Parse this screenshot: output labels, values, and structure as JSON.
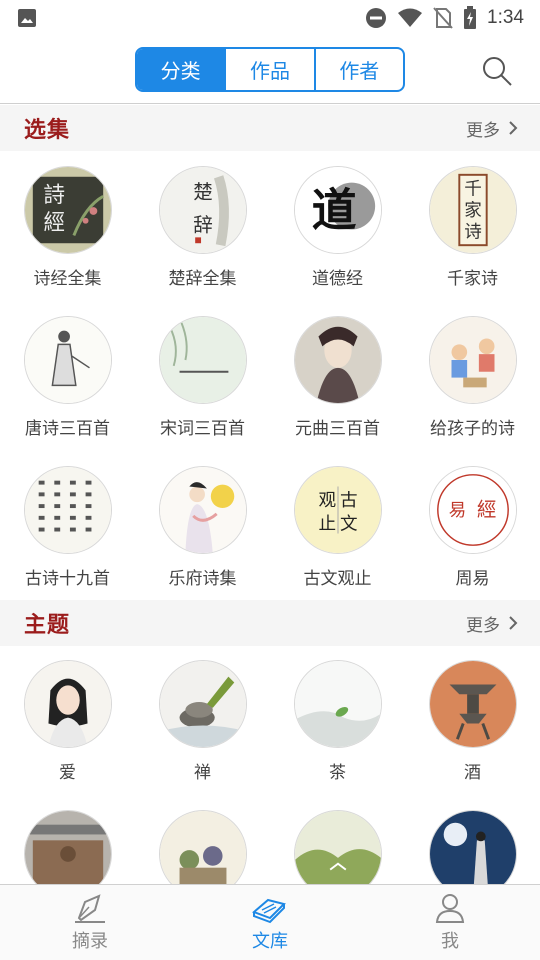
{
  "status_bar": {
    "time": "1:34",
    "icons": [
      "image-notification-icon",
      "do-not-disturb-icon",
      "wifi-icon",
      "no-sim-icon",
      "battery-charging-icon"
    ]
  },
  "header": {
    "tabs": [
      {
        "label": "分类",
        "active": true
      },
      {
        "label": "作品",
        "active": false
      },
      {
        "label": "作者",
        "active": false
      }
    ],
    "search_icon": "search-icon",
    "accent_color": "#1e88e5"
  },
  "sections": {
    "collections": {
      "title": "选集",
      "more": "更多",
      "items": [
        {
          "label": "诗经全集",
          "icon": "shijing-cover"
        },
        {
          "label": "楚辞全集",
          "icon": "chuci-cover"
        },
        {
          "label": "道德经",
          "icon": "daodejing-cover"
        },
        {
          "label": "千家诗",
          "icon": "qianjiashi-cover"
        },
        {
          "label": "唐诗三百首",
          "icon": "tangshi-cover"
        },
        {
          "label": "宋词三百首",
          "icon": "songci-cover"
        },
        {
          "label": "元曲三百首",
          "icon": "yuanqu-cover"
        },
        {
          "label": "给孩子的诗",
          "icon": "children-poems-cover"
        },
        {
          "label": "古诗十九首",
          "icon": "gushi-cover"
        },
        {
          "label": "乐府诗集",
          "icon": "yuefu-cover"
        },
        {
          "label": "古文观止",
          "icon": "guwenguanzhi-cover"
        },
        {
          "label": "周易",
          "icon": "zhouyi-cover"
        }
      ],
      "cover_text": {
        "shijing": [
          "詩",
          "經"
        ],
        "chuci": [
          "楚",
          "辞"
        ],
        "daodejing": "道",
        "qianjiashi": [
          "千",
          "家",
          "诗"
        ],
        "guwen": [
          "观",
          "古",
          "止",
          "文"
        ],
        "zhouyi": [
          "易",
          "經"
        ]
      }
    },
    "themes": {
      "title": "主题",
      "more": "更多",
      "items": [
        {
          "label": "爱",
          "icon": "love-theme"
        },
        {
          "label": "禅",
          "icon": "zen-theme"
        },
        {
          "label": "茶",
          "icon": "tea-theme"
        },
        {
          "label": "酒",
          "icon": "wine-theme"
        },
        {
          "label": "",
          "icon": "war-theme"
        },
        {
          "label": "",
          "icon": "travel-theme"
        },
        {
          "label": "",
          "icon": "landscape-theme"
        },
        {
          "label": "",
          "icon": "moon-theme"
        }
      ]
    }
  },
  "bottom_nav": {
    "items": [
      {
        "label": "摘录",
        "icon": "pen-nib-icon",
        "active": false
      },
      {
        "label": "文库",
        "icon": "books-icon",
        "active": true
      },
      {
        "label": "我",
        "icon": "person-icon",
        "active": false
      }
    ]
  },
  "colors": {
    "section_title": "#9b1c1c",
    "section_bg": "#f5f5f5",
    "active_nav": "#1e88e5",
    "inactive_nav": "#888888"
  }
}
